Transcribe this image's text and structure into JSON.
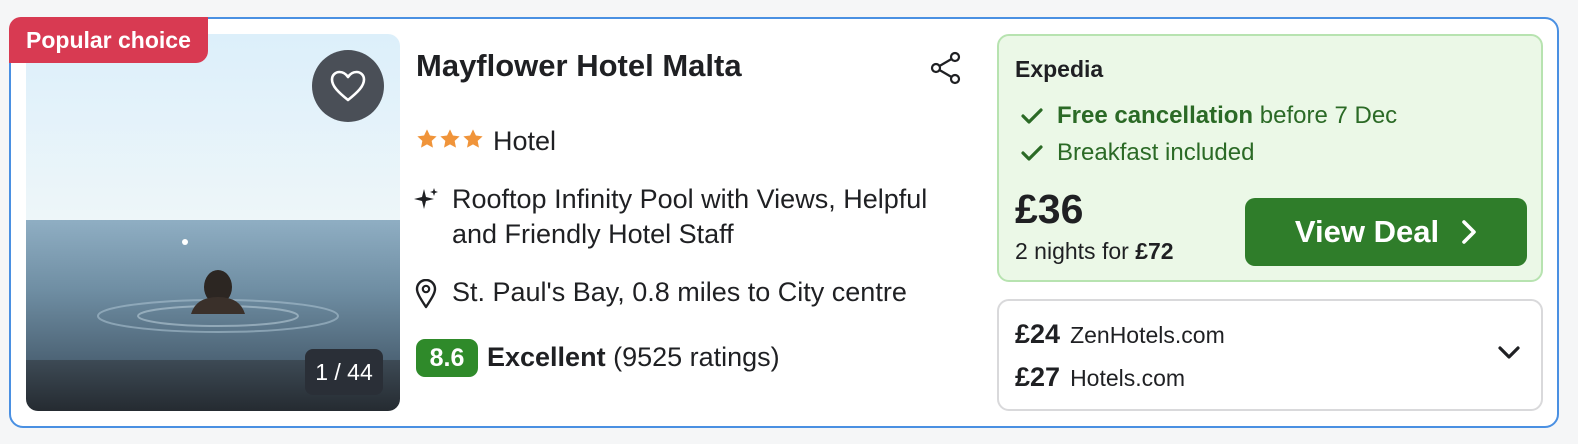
{
  "badge": {
    "label": "Popular choice"
  },
  "photo": {
    "counter": "1 / 44"
  },
  "hotel": {
    "name": "Mayflower Hotel Malta",
    "star_count": 3,
    "type": "Hotel",
    "highlight": "Rooftop Infinity Pool with Views, Helpful and Friendly Hotel Staff",
    "location": "St. Paul's Bay, 0.8 miles to City centre",
    "score": "8.6",
    "rating_label": "Excellent",
    "rating_count": "(9525 ratings)"
  },
  "deal": {
    "provider": "Expedia",
    "feature_1_bold": "Free cancellation",
    "feature_1_rest": "before 7 Dec",
    "feature_2": "Breakfast included",
    "price": "£36",
    "nights_prefix": "2 nights for",
    "nights_total": "£72",
    "button_label": "View Deal"
  },
  "other_offers": [
    {
      "price": "£24",
      "provider": "ZenHotels.com"
    },
    {
      "price": "£27",
      "provider": "Hotels.com"
    }
  ],
  "colors": {
    "badge": "#d83a52",
    "accent_border": "#4a90e2",
    "score_bg": "#2f8a2a",
    "deal_bg": "#ebf8e7",
    "button_bg": "#2f7d2a",
    "star": "#f0943a"
  },
  "icons": {
    "favorite": "heart-icon",
    "share": "share-icon",
    "star": "star-icon",
    "highlight": "sparkle-icon",
    "location": "map-pin-icon",
    "check": "check-icon",
    "button_arrow": "chevron-right-icon",
    "expand": "chevron-down-icon"
  }
}
